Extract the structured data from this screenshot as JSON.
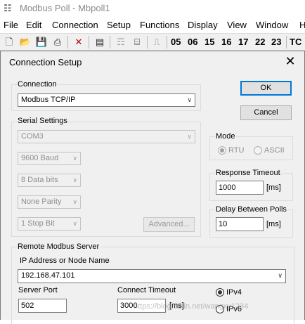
{
  "app": {
    "title": "Modbus Poll - Mbpoll1",
    "menu": [
      "File",
      "Edit",
      "Connection",
      "Setup",
      "Functions",
      "Display",
      "View",
      "Window",
      "H"
    ],
    "toolbar_numbers": [
      "05",
      "06",
      "15",
      "16",
      "17",
      "22",
      "23",
      "TC"
    ]
  },
  "dialog": {
    "title": "Connection Setup",
    "connection": {
      "group_title": "Connection",
      "selected": "Modbus TCP/IP"
    },
    "ok_label": "OK",
    "cancel_label": "Cancel",
    "serial": {
      "group_title": "Serial Settings",
      "port": "COM3",
      "baud": "9600 Baud",
      "data_bits": "8 Data bits",
      "parity": "None Parity",
      "stop_bits": "1 Stop Bit",
      "advanced_label": "Advanced..."
    },
    "mode": {
      "group_title": "Mode",
      "rtu_label": "RTU",
      "ascii_label": "ASCII",
      "selected": "RTU"
    },
    "response_timeout": {
      "group_title": "Response Timeout",
      "value": "1000",
      "unit": "[ms]"
    },
    "delay_between_polls": {
      "group_title": "Delay Between Polls",
      "value": "10",
      "unit": "[ms]"
    },
    "remote": {
      "group_title": "Remote Modbus Server",
      "ip_label": "IP Address or Node Name",
      "ip_value": "192.168.47.101",
      "port_label": "Server Port",
      "port_value": "502",
      "connect_timeout_label": "Connect Timeout",
      "connect_timeout_value": "3000",
      "connect_timeout_unit": "[ms]",
      "ipv4_label": "IPv4",
      "ipv6_label": "IPv6",
      "ip_version_selected": "IPv4"
    }
  },
  "watermark": "https://blog.csdn.net/wangxy1234"
}
